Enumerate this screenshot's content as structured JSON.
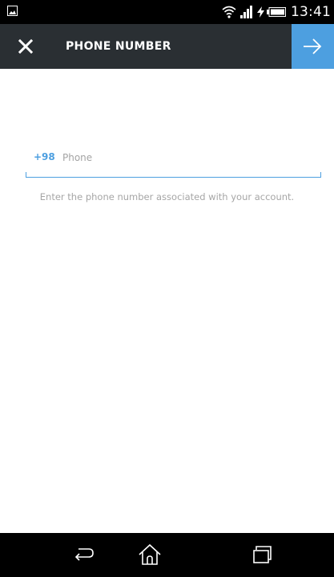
{
  "status_bar": {
    "time": "13:41",
    "icons": [
      "image-notification-icon",
      "wifi-icon",
      "signal-icon",
      "charging-icon",
      "battery-icon"
    ]
  },
  "action_bar": {
    "title": "PHONE NUMBER",
    "close_icon": "close-icon",
    "next_icon": "arrow-right-icon",
    "accent_color": "#4d9fe0"
  },
  "phone_form": {
    "country_code": "+98",
    "phone_value": "",
    "phone_placeholder": "Phone",
    "hint": "Enter the phone number associated with your account."
  },
  "nav_bar": {
    "icons": [
      "back-icon",
      "home-icon",
      "recent-apps-icon"
    ]
  }
}
